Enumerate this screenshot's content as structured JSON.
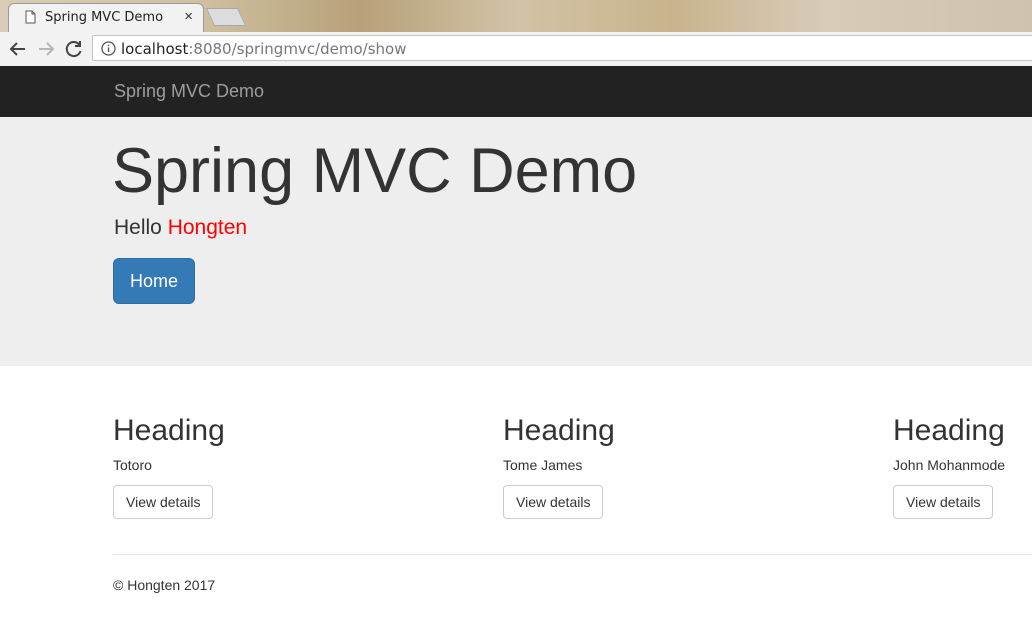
{
  "browser": {
    "tab": {
      "title": "Spring MVC Demo",
      "close_glyph": "×"
    },
    "url": {
      "host": "localhost",
      "path": ":8080/springmvc/demo/show"
    }
  },
  "navbar": {
    "brand": "Spring MVC Demo"
  },
  "jumbotron": {
    "title": "Spring MVC Demo",
    "greeting": "Hello",
    "name": "Hongten",
    "button": "Home"
  },
  "columns": [
    {
      "heading": "Heading",
      "text": "Totoro",
      "button": "View details"
    },
    {
      "heading": "Heading",
      "text": "Tome James",
      "button": "View details"
    },
    {
      "heading": "Heading",
      "text": "John Mohanmode",
      "button": "View details"
    }
  ],
  "footer": {
    "text": "© Hongten 2017"
  },
  "colors": {
    "navbar": "#222222",
    "jumbotron": "#eeeeee",
    "primary_button": "#337ab7",
    "highlight_name": "#ff0000"
  }
}
